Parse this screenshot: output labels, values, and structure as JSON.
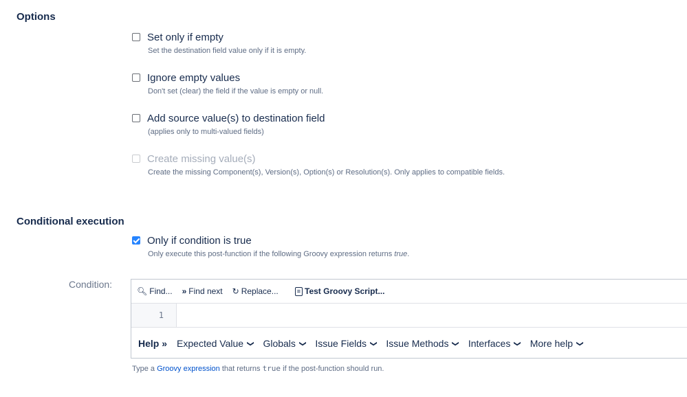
{
  "options": {
    "title": "Options",
    "items": [
      {
        "label": "Set only if empty",
        "desc": "Set the destination field value only if it is empty."
      },
      {
        "label": "Ignore empty values",
        "desc": "Don't set (clear) the field if the value is empty or null."
      },
      {
        "label": "Add source value(s) to destination field",
        "desc": "(applies only to multi-valued fields)"
      },
      {
        "label": "Create missing value(s)",
        "desc": "Create the missing Component(s), Version(s), Option(s) or Resolution(s). Only applies to compatible fields."
      }
    ]
  },
  "conditional": {
    "title": "Conditional execution",
    "checkbox_label": "Only if condition is true",
    "desc_prefix": "Only execute this post-function if the following Groovy expression returns ",
    "desc_italic": "true",
    "desc_suffix": ".",
    "condition_label": "Condition:"
  },
  "toolbar": {
    "find": "Find...",
    "find_next": "Find next",
    "replace": "Replace...",
    "test": "Test Groovy Script..."
  },
  "editor": {
    "line_number": "1"
  },
  "helpbar": {
    "help": "Help",
    "items": [
      "Expected Value",
      "Globals",
      "Issue Fields",
      "Issue Methods",
      "Interfaces",
      "More help"
    ]
  },
  "footnote": {
    "prefix": "Type a ",
    "link": "Groovy expression",
    "middle": " that returns ",
    "code": "true",
    "suffix": " if the post-function should run."
  }
}
